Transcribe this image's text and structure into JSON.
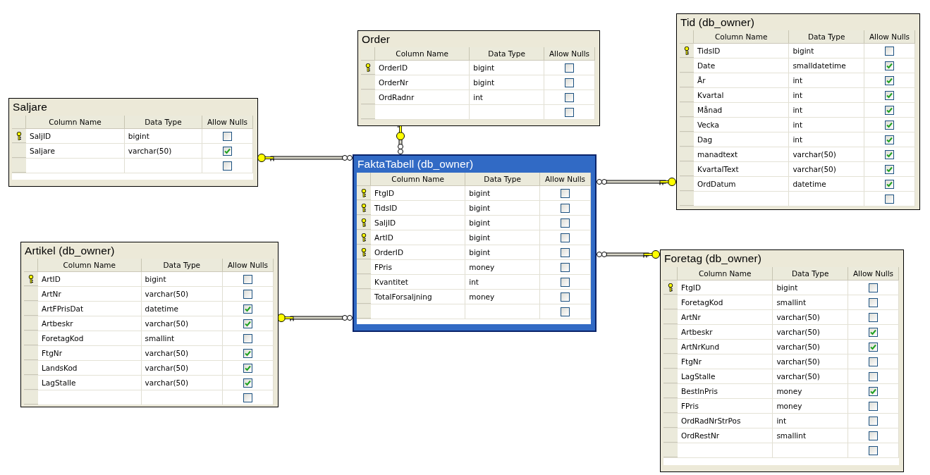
{
  "tables": [
    {
      "title": "Order",
      "selected": false,
      "headers": [
        "Column Name",
        "Data Type",
        "Allow Nulls"
      ],
      "rows": [
        {
          "name": "OrderID",
          "type": "bigint",
          "primary_key": true,
          "allow_nulls": false
        },
        {
          "name": "OrderNr",
          "type": "bigint",
          "primary_key": false,
          "allow_nulls": false
        },
        {
          "name": "OrdRadnr",
          "type": "int",
          "primary_key": false,
          "allow_nulls": false
        }
      ],
      "new_row": {
        "allow_nulls": false
      }
    },
    {
      "title": "Saljare",
      "selected": false,
      "headers": [
        "Column Name",
        "Data Type",
        "Allow Nulls"
      ],
      "rows": [
        {
          "name": "SaljID",
          "type": "bigint",
          "primary_key": true,
          "allow_nulls": false
        },
        {
          "name": "Saljare",
          "type": "varchar(50)",
          "primary_key": false,
          "allow_nulls": true
        }
      ],
      "new_row": {
        "allow_nulls": false
      }
    },
    {
      "title": "Tid (db_owner)",
      "selected": false,
      "headers": [
        "Column Name",
        "Data Type",
        "Allow Nulls"
      ],
      "rows": [
        {
          "name": "TidsID",
          "type": "bigint",
          "primary_key": true,
          "allow_nulls": false
        },
        {
          "name": "Date",
          "type": "smalldatetime",
          "primary_key": false,
          "allow_nulls": true
        },
        {
          "name": "År",
          "type": "int",
          "primary_key": false,
          "allow_nulls": true
        },
        {
          "name": "Kvartal",
          "type": "int",
          "primary_key": false,
          "allow_nulls": true
        },
        {
          "name": "Månad",
          "type": "int",
          "primary_key": false,
          "allow_nulls": true
        },
        {
          "name": "Vecka",
          "type": "int",
          "primary_key": false,
          "allow_nulls": true
        },
        {
          "name": "Dag",
          "type": "int",
          "primary_key": false,
          "allow_nulls": true
        },
        {
          "name": "manadtext",
          "type": "varchar(50)",
          "primary_key": false,
          "allow_nulls": true
        },
        {
          "name": "KvartalText",
          "type": "varchar(50)",
          "primary_key": false,
          "allow_nulls": true
        },
        {
          "name": "OrdDatum",
          "type": "datetime",
          "primary_key": false,
          "allow_nulls": true
        }
      ],
      "new_row": {
        "allow_nulls": false
      }
    },
    {
      "title": "FaktaTabell (db_owner)",
      "selected": true,
      "headers": [
        "Column Name",
        "Data Type",
        "Allow Nulls"
      ],
      "rows": [
        {
          "name": "FtgID",
          "type": "bigint",
          "primary_key": true,
          "allow_nulls": false
        },
        {
          "name": "TidsID",
          "type": "bigint",
          "primary_key": true,
          "allow_nulls": false
        },
        {
          "name": "SaljID",
          "type": "bigint",
          "primary_key": true,
          "allow_nulls": false
        },
        {
          "name": "ArtID",
          "type": "bigint",
          "primary_key": true,
          "allow_nulls": false
        },
        {
          "name": "OrderID",
          "type": "bigint",
          "primary_key": true,
          "allow_nulls": false
        },
        {
          "name": "FPris",
          "type": "money",
          "primary_key": false,
          "allow_nulls": false
        },
        {
          "name": "Kvantitet",
          "type": "int",
          "primary_key": false,
          "allow_nulls": false
        },
        {
          "name": "TotalForsaljning",
          "type": "money",
          "primary_key": false,
          "allow_nulls": false
        }
      ],
      "new_row": {
        "allow_nulls": false
      }
    },
    {
      "title": "Artikel (db_owner)",
      "selected": false,
      "headers": [
        "Column Name",
        "Data Type",
        "Allow Nulls"
      ],
      "rows": [
        {
          "name": "ArtID",
          "type": "bigint",
          "primary_key": true,
          "allow_nulls": false
        },
        {
          "name": "ArtNr",
          "type": "varchar(50)",
          "primary_key": false,
          "allow_nulls": false
        },
        {
          "name": "ArtFPrisDat",
          "type": "datetime",
          "primary_key": false,
          "allow_nulls": true
        },
        {
          "name": "Artbeskr",
          "type": "varchar(50)",
          "primary_key": false,
          "allow_nulls": true
        },
        {
          "name": "ForetagKod",
          "type": "smallint",
          "primary_key": false,
          "allow_nulls": false
        },
        {
          "name": "FtgNr",
          "type": "varchar(50)",
          "primary_key": false,
          "allow_nulls": true
        },
        {
          "name": "LandsKod",
          "type": "varchar(50)",
          "primary_key": false,
          "allow_nulls": true
        },
        {
          "name": "LagStalle",
          "type": "varchar(50)",
          "primary_key": false,
          "allow_nulls": true
        }
      ],
      "new_row": {
        "allow_nulls": false
      }
    },
    {
      "title": "Foretag (db_owner)",
      "selected": false,
      "headers": [
        "Column Name",
        "Data Type",
        "Allow Nulls"
      ],
      "rows": [
        {
          "name": "FtgID",
          "type": "bigint",
          "primary_key": true,
          "allow_nulls": false
        },
        {
          "name": "ForetagKod",
          "type": "smallint",
          "primary_key": false,
          "allow_nulls": false
        },
        {
          "name": "ArtNr",
          "type": "varchar(50)",
          "primary_key": false,
          "allow_nulls": false
        },
        {
          "name": "Artbeskr",
          "type": "varchar(50)",
          "primary_key": false,
          "allow_nulls": true
        },
        {
          "name": "ArtNrKund",
          "type": "varchar(50)",
          "primary_key": false,
          "allow_nulls": true
        },
        {
          "name": "FtgNr",
          "type": "varchar(50)",
          "primary_key": false,
          "allow_nulls": false
        },
        {
          "name": "LagStalle",
          "type": "varchar(50)",
          "primary_key": false,
          "allow_nulls": false
        },
        {
          "name": "BestInPris",
          "type": "money",
          "primary_key": false,
          "allow_nulls": true
        },
        {
          "name": "FPris",
          "type": "money",
          "primary_key": false,
          "allow_nulls": false
        },
        {
          "name": "OrdRadNrStrPos",
          "type": "int",
          "primary_key": false,
          "allow_nulls": false
        },
        {
          "name": "OrdRestNr",
          "type": "smallint",
          "primary_key": false,
          "allow_nulls": false
        }
      ],
      "new_row": {
        "allow_nulls": false
      }
    }
  ]
}
